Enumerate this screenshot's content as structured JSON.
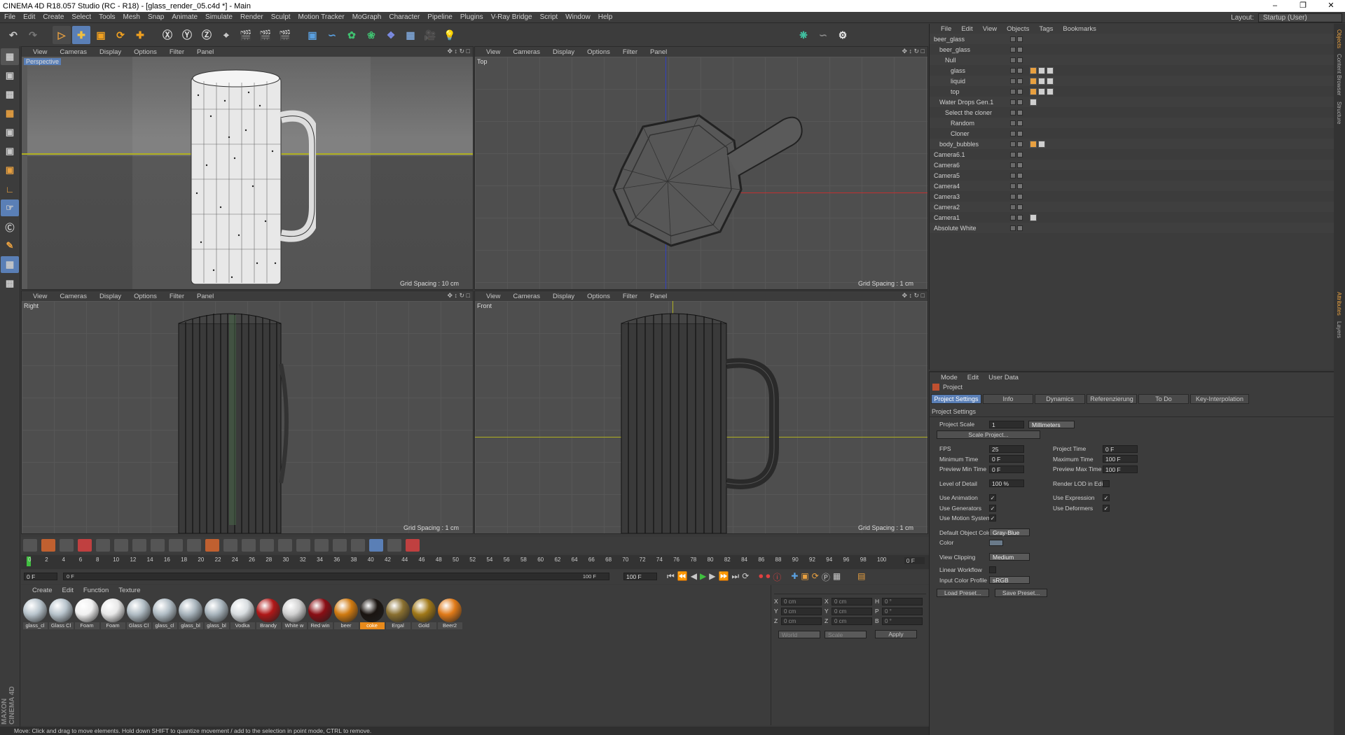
{
  "window": {
    "title": "CINEMA 4D R18.057 Studio (RC - R18) - [glass_render_05.c4d *] - Main"
  },
  "menu": [
    "File",
    "Edit",
    "Create",
    "Select",
    "Tools",
    "Mesh",
    "Snap",
    "Animate",
    "Simulate",
    "Render",
    "Sculpt",
    "Motion Tracker",
    "MoGraph",
    "Character",
    "Pipeline",
    "Plugins",
    "V-Ray Bridge",
    "Script",
    "Window",
    "Help"
  ],
  "layout": {
    "label": "Layout:",
    "value": "Startup (User)"
  },
  "viewport_menu": [
    "View",
    "Cameras",
    "Display",
    "Options",
    "Filter",
    "Panel"
  ],
  "viewports": {
    "perspective": {
      "label": "Perspective",
      "grid": "Grid Spacing : 10 cm"
    },
    "top": {
      "label": "Top",
      "grid": "Grid Spacing : 1 cm"
    },
    "right": {
      "label": "Right",
      "grid": "Grid Spacing : 1 cm"
    },
    "front": {
      "label": "Front",
      "grid": "Grid Spacing : 1 cm"
    }
  },
  "object_manager": {
    "menu": [
      "File",
      "Edit",
      "View",
      "Objects",
      "Tags",
      "Bookmarks"
    ],
    "objects": [
      {
        "name": "beer_glass",
        "indent": 0
      },
      {
        "name": "beer_glass",
        "indent": 1
      },
      {
        "name": "Null",
        "indent": 2
      },
      {
        "name": "glass",
        "indent": 3
      },
      {
        "name": "liquid",
        "indent": 3
      },
      {
        "name": "top",
        "indent": 3
      },
      {
        "name": "Water Drops Gen.1",
        "indent": 1
      },
      {
        "name": "Select the cloner",
        "indent": 2
      },
      {
        "name": "Random",
        "indent": 3
      },
      {
        "name": "Cloner",
        "indent": 3
      },
      {
        "name": "body_bubbles",
        "indent": 1
      },
      {
        "name": "Camera6.1",
        "indent": 0
      },
      {
        "name": "Camera6",
        "indent": 0
      },
      {
        "name": "Camera5",
        "indent": 0
      },
      {
        "name": "Camera4",
        "indent": 0
      },
      {
        "name": "Camera3",
        "indent": 0
      },
      {
        "name": "Camera2",
        "indent": 0
      },
      {
        "name": "Camera1",
        "indent": 0
      },
      {
        "name": "Absolute White",
        "indent": 0
      }
    ]
  },
  "attributes": {
    "menu": [
      "Mode",
      "Edit",
      "User Data"
    ],
    "object": "Project",
    "tabs": [
      "Project Settings",
      "Info",
      "Dynamics",
      "Referenzierung",
      "To Do",
      "Key-Interpolation"
    ],
    "section": "Project Settings",
    "project_scale": {
      "label": "Project Scale",
      "value": "1",
      "unit": "Millimeters"
    },
    "scale_button": "Scale Project...",
    "fps": {
      "label": "FPS",
      "value": "25"
    },
    "project_time": {
      "label": "Project Time",
      "value": "0 F"
    },
    "min_time": {
      "label": "Minimum Time",
      "value": "0 F"
    },
    "max_time": {
      "label": "Maximum Time",
      "value": "100 F"
    },
    "preview_min": {
      "label": "Preview Min Time",
      "value": "0 F"
    },
    "preview_max": {
      "label": "Preview Max Time",
      "value": "100 F"
    },
    "lod": {
      "label": "Level of Detail",
      "value": "100 %"
    },
    "render_lod": {
      "label": "Render LOD in Editor"
    },
    "use_animation": "Use Animation",
    "use_expression": "Use Expression",
    "use_generators": "Use Generators",
    "use_deformers": "Use Deformers",
    "use_motion": "Use Motion System",
    "default_color": {
      "label": "Default Object Color",
      "value": "Gray-Blue"
    },
    "color": {
      "label": "Color"
    },
    "view_clipping": {
      "label": "View Clipping",
      "value": "Medium"
    },
    "linear_workflow": "Linear Workflow",
    "input_color": {
      "label": "Input Color Profile",
      "value": "sRGB"
    },
    "load_preset": "Load Preset...",
    "save_preset": "Save Preset..."
  },
  "timeline": {
    "ticks": [
      "0",
      "2",
      "4",
      "6",
      "8",
      "10",
      "12",
      "14",
      "16",
      "18",
      "20",
      "22",
      "24",
      "26",
      "28",
      "30",
      "32",
      "34",
      "36",
      "38",
      "40",
      "42",
      "44",
      "46",
      "48",
      "50",
      "52",
      "54",
      "56",
      "58",
      "60",
      "62",
      "64",
      "66",
      "68",
      "70",
      "72",
      "74",
      "76",
      "78",
      "80",
      "82",
      "84",
      "86",
      "88",
      "90",
      "92",
      "94",
      "96",
      "98",
      "100"
    ],
    "current": "0 F",
    "start": "0 F",
    "end": "100 F",
    "slider_left": "0 F",
    "slider_right": "100 F"
  },
  "materials": {
    "menu": [
      "Create",
      "Edit",
      "Function",
      "Texture"
    ],
    "items": [
      {
        "name": "glass_cl",
        "color": "#b8c4cc"
      },
      {
        "name": "Glass Cl",
        "color": "#b8c4cc"
      },
      {
        "name": "Foam",
        "color": "#f0f0f0"
      },
      {
        "name": "Foam",
        "color": "#e8e8e8"
      },
      {
        "name": "Glass Cl",
        "color": "#b0bcc4"
      },
      {
        "name": "glass_cl",
        "color": "#b0bcc4"
      },
      {
        "name": "glass_bl",
        "color": "#a8b4bc"
      },
      {
        "name": "glass_bl",
        "color": "#a8b4bc"
      },
      {
        "name": "Vodka",
        "color": "#d8dde0"
      },
      {
        "name": "Brandy",
        "color": "#b01818"
      },
      {
        "name": "White w",
        "color": "#d0d0d0"
      },
      {
        "name": "Red win",
        "color": "#8a0e14"
      },
      {
        "name": "beer",
        "color": "#d07a10"
      },
      {
        "name": "coke",
        "color": "#1a1410"
      },
      {
        "name": "Ergal",
        "color": "#8a7030"
      },
      {
        "name": "Gold",
        "color": "#a07818"
      },
      {
        "name": "Beer2",
        "color": "#e07a18"
      }
    ],
    "selected_index": 13
  },
  "coords": {
    "rows": [
      {
        "a": "X",
        "v1": "0 cm",
        "b": "X",
        "v2": "0 cm",
        "c": "H",
        "v3": "0 °"
      },
      {
        "a": "Y",
        "v1": "0 cm",
        "b": "Y",
        "v2": "0 cm",
        "c": "P",
        "v3": "0 °"
      },
      {
        "a": "Z",
        "v1": "0 cm",
        "b": "Z",
        "v2": "0 cm",
        "c": "B",
        "v3": "0 °"
      }
    ],
    "world": "World",
    "scale": "Scale",
    "apply": "Apply"
  },
  "status": "Move: Click and drag to move elements. Hold down SHIFT to quantize movement / add to the selection in point mode, CTRL to remove.",
  "brand": "MAXON CINEMA 4D",
  "side_tabs": [
    "Objects",
    "Content Browser",
    "Structure",
    "Attributes",
    "Layers"
  ]
}
